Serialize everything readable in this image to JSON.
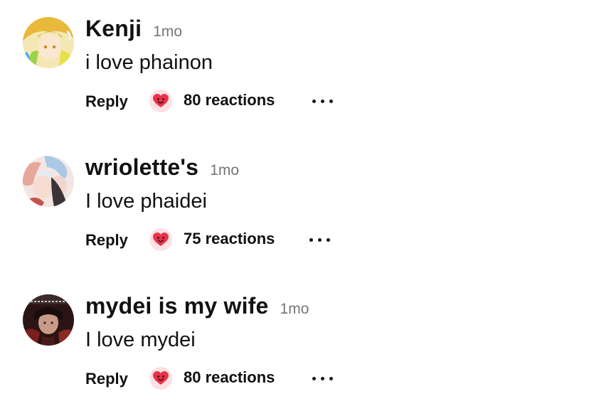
{
  "comments": [
    {
      "username": "Kenji",
      "timestamp": "1mo",
      "text": "i love phainon",
      "reply_label": "Reply",
      "reactions_label": "80 reactions",
      "reaction_icon": "heart-face-icon",
      "more_icon": "more-options-icon"
    },
    {
      "username": "wriolette's",
      "timestamp": "1mo",
      "text": "I love phaidei",
      "reply_label": "Reply",
      "reactions_label": "75 reactions",
      "reaction_icon": "heart-face-icon",
      "more_icon": "more-options-icon"
    },
    {
      "username": "mydei is my wife",
      "timestamp": "1mo",
      "text": "I love mydei",
      "reply_label": "Reply",
      "reactions_label": "80 reactions",
      "reaction_icon": "heart-face-icon",
      "more_icon": "more-options-icon"
    }
  ],
  "colors": {
    "text": "#111111",
    "timestamp": "#767676",
    "reaction_bg": "#fde1e4",
    "heart": "#e8334a"
  }
}
